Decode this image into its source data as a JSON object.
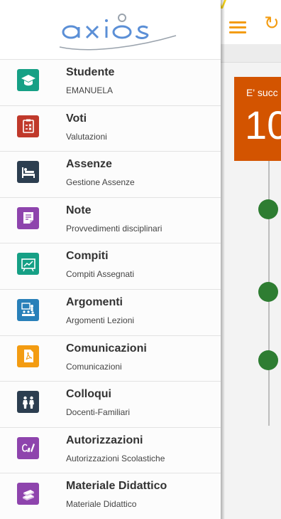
{
  "app": {
    "brand_color": "#f39c12",
    "drawer_logo": {
      "name": "axios-logo",
      "color": "#5b8fd6"
    }
  },
  "main": {
    "notification_text": "E' succ",
    "notification_number": "10",
    "card_color": "#d35400",
    "timeline_dot_color": "#2e7d32"
  },
  "drawer": {
    "items": [
      {
        "title": "Studente",
        "subtitle": "EMANUELA",
        "icon": "graduation-cap-icon",
        "color": "#16a085"
      },
      {
        "title": "Voti",
        "subtitle": "Valutazioni",
        "icon": "clipboard-marks-icon",
        "color": "#c0392b"
      },
      {
        "title": "Assenze",
        "subtitle": "Gestione Assenze",
        "icon": "bed-icon",
        "color": "#2c3e50"
      },
      {
        "title": "Note",
        "subtitle": "Provvedimenti disciplinari",
        "icon": "note-icon",
        "color": "#8e44ad"
      },
      {
        "title": "Compiti",
        "subtitle": "Compiti Assegnati",
        "icon": "blackboard-chart-icon",
        "color": "#16a085"
      },
      {
        "title": "Argomenti",
        "subtitle": "Argomenti Lezioni",
        "icon": "classroom-icon",
        "color": "#2980b9"
      },
      {
        "title": "Comunicazioni",
        "subtitle": "Comunicazioni",
        "icon": "pdf-document-icon",
        "color": "#f39c12"
      },
      {
        "title": "Colloqui",
        "subtitle": "Docenti-Familiari",
        "icon": "people-icon",
        "color": "#2c3e50"
      },
      {
        "title": "Autorizzazioni",
        "subtitle": "Autorizzazioni Scolastiche",
        "icon": "signature-icon",
        "color": "#8e44ad"
      },
      {
        "title": "Materiale Didattico",
        "subtitle": "Materiale Didattico",
        "icon": "books-icon",
        "color": "#8e44ad"
      }
    ]
  }
}
